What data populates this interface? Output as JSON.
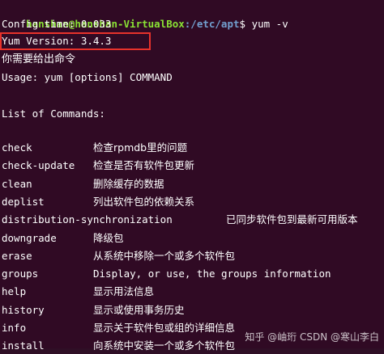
{
  "prompt": {
    "user_host": "hanshan@hanshan-VirtualBox",
    "path": ":/etc/apt",
    "symbol": "$",
    "command": " yum -v"
  },
  "output": {
    "config_time": "Config time: 0.033",
    "yum_version": "Yum Version: 3.4.3",
    "need_command": "你需要给出命令",
    "usage": "Usage: yum [options] COMMAND",
    "list_header": "List of Commands:"
  },
  "commands": [
    {
      "name": "check",
      "desc": "检查rpmdb里的问题"
    },
    {
      "name": "check-update",
      "desc": "检查是否有软件包更新"
    },
    {
      "name": "clean",
      "desc": "删除缓存的数据"
    },
    {
      "name": "deplist",
      "desc": "列出软件包的依赖关系"
    },
    {
      "name": "distribution-synchronization",
      "desc": "已同步软件包到最新可用版本"
    },
    {
      "name": "downgrade",
      "desc": "降级包"
    },
    {
      "name": "erase",
      "desc": "从系统中移除一个或多个软件包"
    },
    {
      "name": "groups",
      "desc": "Display, or use, the groups information"
    },
    {
      "name": "help",
      "desc": "显示用法信息"
    },
    {
      "name": "history",
      "desc": "显示或使用事务历史"
    },
    {
      "name": "info",
      "desc": "显示关于软件包或组的详细信息"
    },
    {
      "name": "install",
      "desc": "向系统中安装一个或多个软件包"
    }
  ],
  "watermark": "CSDN @寒山李白",
  "watermark_zhihu": "知乎 @岫珩",
  "colors": {
    "background": "#300a24",
    "prompt_user": "#8ae234",
    "prompt_path": "#729fcf",
    "highlight": "#e8322b"
  }
}
